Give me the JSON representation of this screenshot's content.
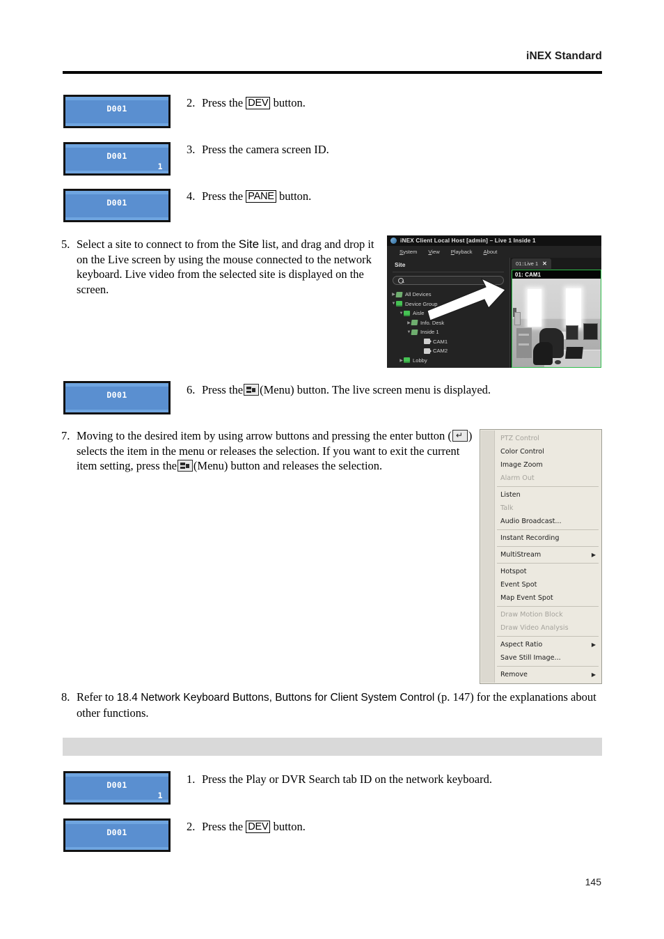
{
  "header": {
    "title": "iNEX Standard"
  },
  "page_number": "145",
  "steps": {
    "step2": {
      "num": "2.",
      "pre": "Press the",
      "key": "DEV",
      "post": "button.",
      "lcd_line1": "D001",
      "lcd_line2": ""
    },
    "step3": {
      "num": "3.",
      "text": "Press the camera screen ID.",
      "lcd_line1": "D001",
      "lcd_line2": "1"
    },
    "step4": {
      "num": "4.",
      "pre": "Press the",
      "key": "PANE",
      "post": "button.",
      "lcd_line1": "D001",
      "lcd_line2": ""
    },
    "step5": {
      "num": "5.",
      "line1_a": "Select a site to connect to from the",
      "line1_emph": "Site",
      "line1_b": "list, and drag and",
      "line2": "drop it on the Live screen by using the mouse connected",
      "line3": "to the network keyboard.  Live video from the selected site",
      "line4": "is displayed on the screen."
    },
    "step6": {
      "num": "6.",
      "pre": "Press the",
      "icon": "menu-icon",
      "post": "(Menu) button.  The live screen menu is displayed.",
      "lcd_line1": "D001",
      "lcd_line2": ""
    },
    "step7": {
      "num": "7.",
      "line1": "Moving to the desired item by using arrow buttons and pressing the enter",
      "line2_a": "button (",
      "line2_icon": "enter-icon",
      "line2_b": ") selects the item in the menu or releases the selection.  If you",
      "line3_a": "want to exit the current item setting, press the",
      "line3_icon": "menu-icon",
      "line3_b": "(Menu) button and releases",
      "line4": "the selection."
    },
    "step8": {
      "num": "8.",
      "pre": "Refer to",
      "emph": "18.4 Network Keyboard Buttons, Buttons for Client System Control",
      "post": "(p. 147) for the",
      "line2": "explanations about other functions."
    },
    "step_b1": {
      "num": "1.",
      "text": "Press the Play or DVR Search tab ID on the network keyboard.",
      "lcd_line1": "D001",
      "lcd_line2": "1"
    },
    "step_b2": {
      "num": "2.",
      "pre": "Press the",
      "key": "DEV",
      "post": "button.",
      "lcd_line1": "D001",
      "lcd_line2": ""
    }
  },
  "inex_screenshot": {
    "window_title": "iNEX Client Local Host [admin] – Live  1  Inside 1",
    "menubar": [
      {
        "accel": "S",
        "rest": "ystem"
      },
      {
        "accel": "V",
        "rest": "iew"
      },
      {
        "accel": "P",
        "rest": "layback"
      },
      {
        "accel": "A",
        "rest": "bout"
      }
    ],
    "site_panel_title": "Site",
    "search_placeholder": "",
    "tree": [
      {
        "label": "All Devices",
        "indent": 0,
        "tri": "▶",
        "icon": "device"
      },
      {
        "label": "Device Group",
        "indent": 0,
        "tri": "▼",
        "icon": "group"
      },
      {
        "label": "Aisle",
        "indent": 1,
        "tri": "▼",
        "icon": "group"
      },
      {
        "label": "Info. Desk",
        "indent": 2,
        "tri": "▶",
        "icon": "device"
      },
      {
        "label": "Inside 1",
        "indent": 2,
        "tri": "▼",
        "icon": "device"
      },
      {
        "label": "CAM1",
        "indent": 3,
        "tri": "",
        "icon": "camera"
      },
      {
        "label": "CAM2",
        "indent": 3,
        "tri": "",
        "icon": "camera"
      },
      {
        "label": "Lobby",
        "indent": 1,
        "tri": "▶",
        "icon": "group"
      }
    ],
    "tab_label": "01::Live  1",
    "tab_close": "✕",
    "video_osd": "01: CAM1"
  },
  "live_menu": {
    "items": [
      {
        "label": "PTZ Control",
        "disabled": true,
        "submenu": false,
        "sep_after": false
      },
      {
        "label": "Color Control",
        "disabled": false,
        "submenu": false,
        "sep_after": false
      },
      {
        "label": "Image Zoom",
        "disabled": false,
        "submenu": false,
        "sep_after": false
      },
      {
        "label": "Alarm Out",
        "disabled": true,
        "submenu": false,
        "sep_after": true
      },
      {
        "label": "Listen",
        "disabled": false,
        "submenu": false,
        "sep_after": false
      },
      {
        "label": "Talk",
        "disabled": true,
        "submenu": false,
        "sep_after": false
      },
      {
        "label": "Audio Broadcast...",
        "disabled": false,
        "submenu": false,
        "sep_after": true
      },
      {
        "label": "Instant Recording",
        "disabled": false,
        "submenu": false,
        "sep_after": true
      },
      {
        "label": "MultiStream",
        "disabled": false,
        "submenu": true,
        "sep_after": true
      },
      {
        "label": "Hotspot",
        "disabled": false,
        "submenu": false,
        "sep_after": false
      },
      {
        "label": "Event Spot",
        "disabled": false,
        "submenu": false,
        "sep_after": false
      },
      {
        "label": "Map Event Spot",
        "disabled": false,
        "submenu": false,
        "sep_after": true
      },
      {
        "label": "Draw Motion Block",
        "disabled": true,
        "submenu": false,
        "sep_after": false
      },
      {
        "label": "Draw Video Analysis",
        "disabled": true,
        "submenu": false,
        "sep_after": true
      },
      {
        "label": "Aspect Ratio",
        "disabled": false,
        "submenu": true,
        "sep_after": false
      },
      {
        "label": "Save Still Image...",
        "disabled": false,
        "submenu": false,
        "sep_after": true
      },
      {
        "label": "Remove",
        "disabled": false,
        "submenu": true,
        "sep_after": false
      }
    ],
    "submenu_arrow": "▶"
  },
  "colors": {
    "lcd_body": "#5a8fd0",
    "lcd_strip": "#6fa5e0",
    "lcd_border": "#121212",
    "band": "#d9d9d9",
    "menu_bg": "#ece9e0",
    "cell_border": "#2fbf4a"
  }
}
